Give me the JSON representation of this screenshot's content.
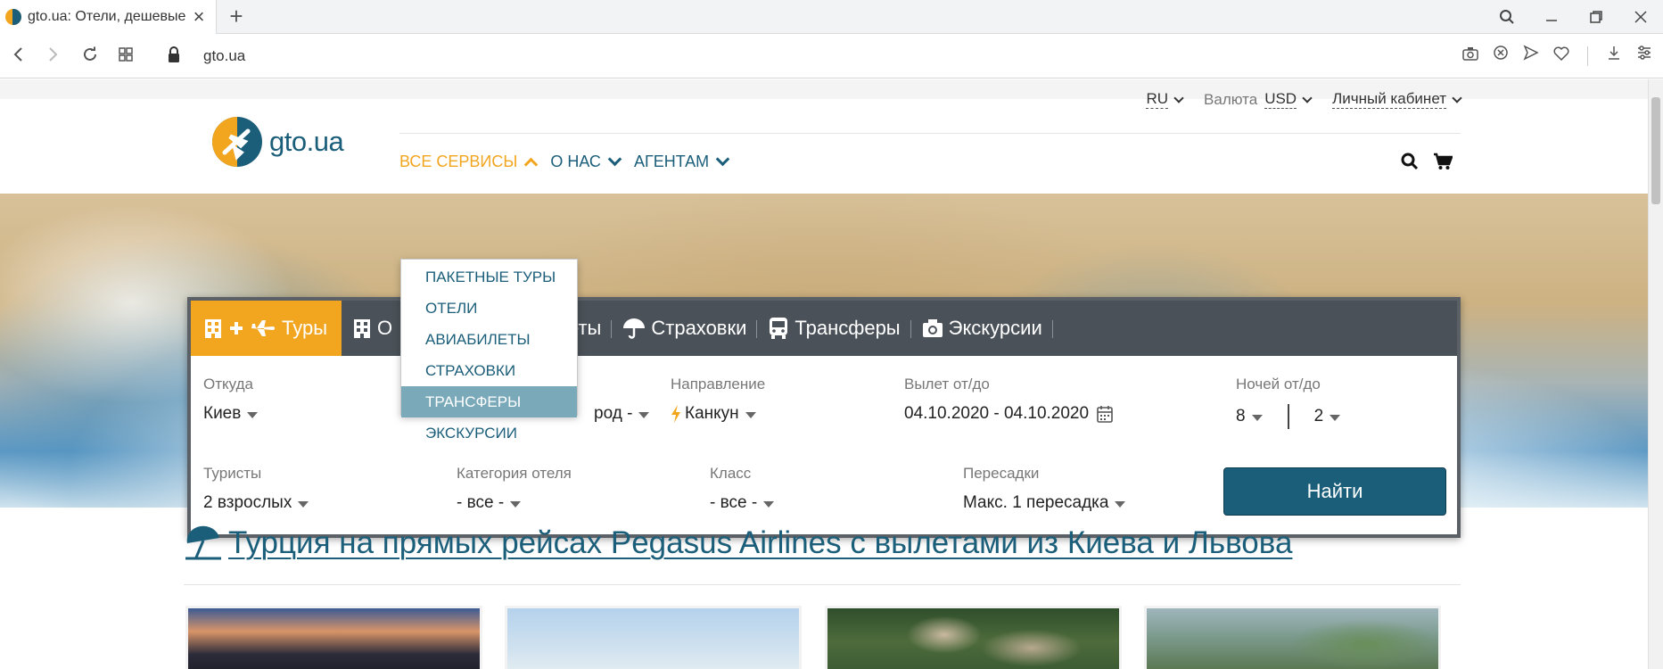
{
  "browser": {
    "tab_title": "gto.ua: Отели, дешевые авиабилеты",
    "url": "gto.ua"
  },
  "header": {
    "logo_text": "gto.ua",
    "lang": "RU",
    "currency_label": "Валюта",
    "currency": "USD",
    "cabinet": "Личный кабинет",
    "nav": {
      "services": "ВСЕ СЕРВИСЫ",
      "about": "О НАС",
      "agents": "АГЕНТАМ"
    }
  },
  "dropdown": {
    "items": [
      "ПАКЕТНЫЕ ТУРЫ",
      "ОТЕЛИ",
      "АВИАБИЛЕТЫ",
      "СТРАХОВКИ",
      "ТРАНСФЕРЫ",
      "ЭКСКУРСИИ"
    ],
    "hovered": "ТРАНСФЕРЫ"
  },
  "search": {
    "tabs": {
      "tours": "Туры",
      "hotels": "О",
      "flights": "леты",
      "insurance": "Страховки",
      "transfers": "Трансферы",
      "excursions": "Экскурсии"
    },
    "from_label": "Откуда",
    "from_value": "Киев",
    "city_value": "род -",
    "direction_label": "Направление",
    "direction_value": "Канкун",
    "dates_label": "Вылет от/до",
    "dates_value": "04.10.2020 - 04.10.2020",
    "nights_label": "Ночей от/до",
    "nights_from": "8",
    "nights_to": "2",
    "tourists_label": "Туристы",
    "tourists_value": "2 взрослых",
    "category_label": "Категория отеля",
    "category_value": "- все -",
    "class_label": "Класс",
    "class_value": "- все -",
    "transfers_label": "Пересадки",
    "transfers_value": "Макс. 1 пересадка",
    "find_button": "Найти"
  },
  "promo": {
    "title": "Турция на прямых рейсах Pegasus Airlines с вылетами из Киева и Львова"
  },
  "colors": {
    "brand_blue": "#1b5e7a",
    "brand_orange": "#f2a61f",
    "dropdown_hover": "#7aa9b9"
  }
}
